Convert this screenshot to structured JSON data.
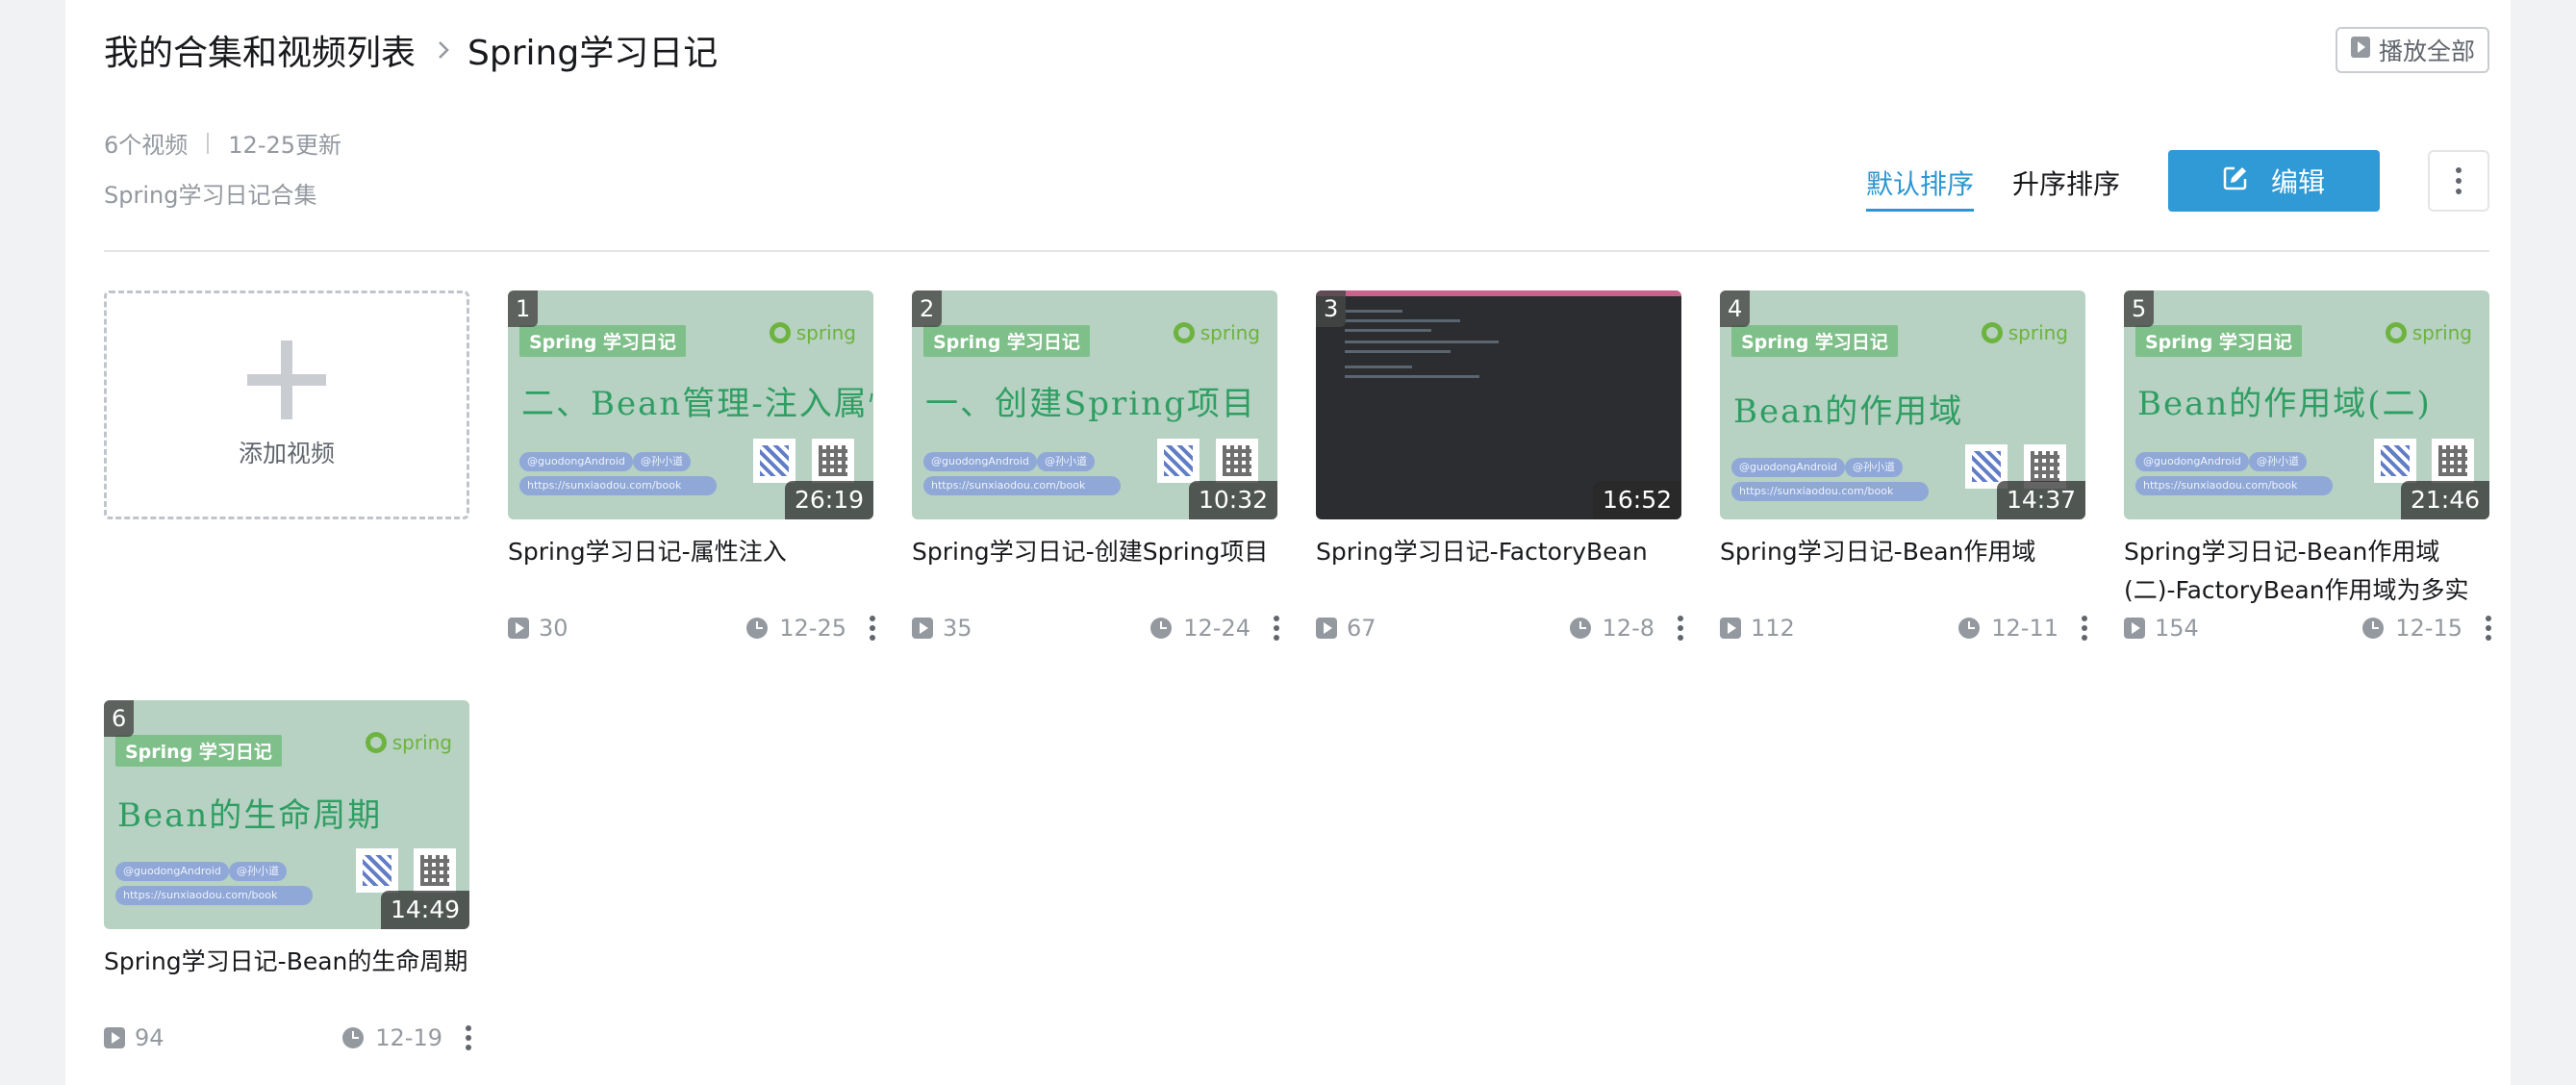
{
  "breadcrumb": {
    "root": "我的合集和视频列表",
    "current": "Spring学习日记"
  },
  "header": {
    "play_all": "播放全部"
  },
  "collection": {
    "video_count": "6个视频",
    "updated": "12-25更新",
    "description": "Spring学习日记合集"
  },
  "sort": {
    "default_label": "默认排序",
    "asc_label": "升序排序"
  },
  "actions": {
    "edit_label": "编辑"
  },
  "add_video": {
    "label": "添加视频"
  },
  "thumb_common": {
    "tag": "Spring 学习日记",
    "logo": "spring",
    "chip1": "@guodongAndroid",
    "chip2": "@孙小道",
    "chip3": "https://sunxiaodou.com/book"
  },
  "colors": {
    "accent": "#2d95d0",
    "edit_button": "#2f9ad6",
    "spring_green": "#6db33f"
  },
  "videos": [
    {
      "index": "1",
      "duration": "26:19",
      "thumb_text": "二、Bean管理-注入属性",
      "title": "Spring学习日记-属性注入",
      "plays": "30",
      "date": "12-25"
    },
    {
      "index": "2",
      "duration": "10:32",
      "thumb_text": "一、创建Spring项目",
      "title": "Spring学习日记-创建Spring项目",
      "plays": "35",
      "date": "12-24"
    },
    {
      "index": "3",
      "duration": "16:52",
      "thumb_text": "",
      "title": "Spring学习日记-FactoryBean",
      "plays": "67",
      "date": "12-8"
    },
    {
      "index": "4",
      "duration": "14:37",
      "thumb_text": "Bean的作用域",
      "title": "Spring学习日记-Bean作用域",
      "plays": "112",
      "date": "12-11"
    },
    {
      "index": "5",
      "duration": "21:46",
      "thumb_text": "Bean的作用域(二)",
      "title": "Spring学习日记-Bean作用域(二)-FactoryBean作用域为多实例时，",
      "plays": "154",
      "date": "12-15"
    },
    {
      "index": "6",
      "duration": "14:49",
      "thumb_text": "Bean的生命周期",
      "title": "Spring学习日记-Bean的生命周期",
      "plays": "94",
      "date": "12-19"
    }
  ]
}
